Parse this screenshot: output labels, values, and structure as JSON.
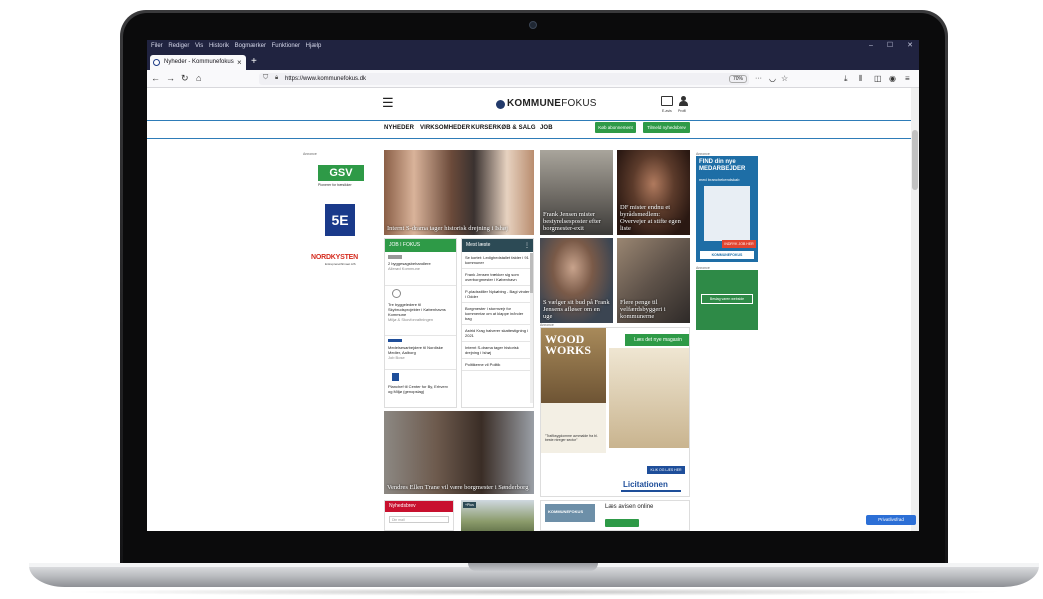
{
  "browser": {
    "menu": [
      "Filer",
      "Rediger",
      "Vis",
      "Historik",
      "Bogmærker",
      "Funktioner",
      "Hjælp"
    ],
    "tab_title": "Nyheder - Kommunefokus",
    "url": "https://www.kommunefokus.dk",
    "zoom": "70%",
    "colors": {
      "titlebar": "#202340",
      "toolbar": "#f9f9fb"
    }
  },
  "site": {
    "logo_bold": "KOMMUNE",
    "logo_light": "FOKUS",
    "avis_label": "E-avis",
    "profil_label": "Profil",
    "nav": [
      "NYHEDER",
      "VIRKSOMHEDER",
      "KURSER",
      "KØB & SALG",
      "JOB"
    ],
    "buttons": {
      "subscribe": "Køb abonnement",
      "newsletter": "Tilmeld nyhedsbrev"
    },
    "accent_color": "#2e9a47",
    "brand_blue": "#2e7cb8",
    "annonce": "Annonce",
    "left_ads": {
      "gsv": "GSV",
      "gsv_sub": "Pionerer for træsikker",
      "five_e": "5E",
      "nordkysten": "NORDKYSTEN",
      "nordkysten_sub": "Entreprenørfirmaet A/S"
    },
    "tiles": {
      "main": "Internt S-drama tager historisk drejning i Ishøj",
      "t2": "Frank Jensen mister bestyrelsesposter efter borgmester-exit",
      "t3": "DF mister endnu et byrådsmedlem: Overvejer at stifte egen liste",
      "t4": "S vælger sit bud på Frank Jensens afløser om en uge",
      "t5": "Flere penge til velfærdsbyggeri i kommunerne",
      "t6": "Vendres Ellen Trane vil være borgmester i Sønderborg"
    },
    "job_box": {
      "title": "JOB I FOKUS",
      "items": [
        {
          "title": "2 byggesagsbehandlere",
          "org": "Allerød Kommune"
        },
        {
          "title": "Tre byggeledere til Skybrudsprojekter i Københavns Kommune",
          "org": "Miljø & Skovforvaltningen"
        },
        {
          "title": "Medelsesarbejdere til Nordiske Medier, Aalborg",
          "org": "Job Bose"
        },
        {
          "title": "Planchef til Center for By, Erhverv og Miljø (genopslag)",
          "org": ""
        }
      ]
    },
    "most_read": {
      "title": "Mest læste",
      "items": [
        "Se kortet: Ledighedstallet falder i 91 kommuner",
        "Frank Jensen trækker sig som overborgmester i København",
        "P-pladsstiller Nykøbing - Bagi vinder i Odder",
        "Borgmester i stormvejr for kommentar om at klappe in/inder bag",
        "Astrid Krag halverer skattestigning i 2021",
        "Internt S-drama tager historisk drejning i Ishøj",
        "Politikerne vil Politik"
      ]
    },
    "right_ad": {
      "title": "FIND din nye MEDARBEJDER",
      "sub": "med branchekendskab",
      "cta": "INDRYK JOB HER",
      "brand": "KOMMUNEFOKUS"
    },
    "right_ad2": {
      "cta": "Beslag varen webside"
    },
    "big_ad": {
      "badge": "Læs det nye magasin",
      "headline": "WOOD WORKS",
      "brand": "Licitationen",
      "tag": "KLIK OG LÆS HER",
      "snippet": "\"Trafiksygdomme avnmalde fra bl. beste ntreger sector\""
    },
    "nyhedsbrev": {
      "title": "Nyhedsbrev",
      "placeholder": "Din mail"
    },
    "plus": "+Plus",
    "avis_online": {
      "title": "Læs avisen online",
      "logo_bold": "KOMMUNE",
      "logo_light": "FOKUS"
    },
    "privacy": "Privatlivsfrad"
  }
}
